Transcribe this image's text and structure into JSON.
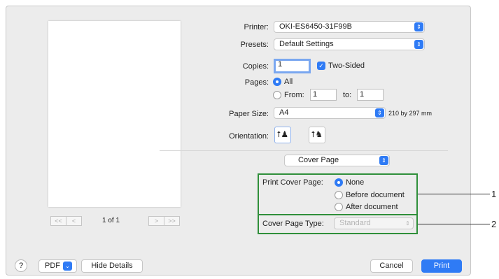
{
  "pager": {
    "first": "<<",
    "prev": "<",
    "label": "1 of 1",
    "next": ">",
    "last": ">>"
  },
  "printer": {
    "label": "Printer:",
    "value": "OKI-ES6450-31F99B"
  },
  "presets": {
    "label": "Presets:",
    "value": "Default Settings"
  },
  "copies": {
    "label": "Copies:",
    "value": "1",
    "two_sided_label": "Two-Sided",
    "two_sided_checked": true
  },
  "pages": {
    "label": "Pages:",
    "all_label": "All",
    "from_label": "From:",
    "from_value": "1",
    "to_label": "to:",
    "to_value": "1",
    "selected": "All"
  },
  "paper_size": {
    "label": "Paper Size:",
    "value": "A4",
    "dimensions": "210 by 297 mm"
  },
  "orientation": {
    "label": "Orientation:",
    "options": [
      "portrait",
      "landscape"
    ],
    "selected": "portrait"
  },
  "section": {
    "value": "Cover Page"
  },
  "cover_page": {
    "label": "Print Cover Page:",
    "options": [
      "None",
      "Before document",
      "After document"
    ],
    "selected": "None",
    "type_label": "Cover Page Type:",
    "type_value": "Standard"
  },
  "callouts": [
    "1",
    "2"
  ],
  "bottom": {
    "help": "?",
    "pdf": "PDF",
    "hide_details": "Hide Details",
    "cancel": "Cancel",
    "print": "Print"
  },
  "colors": {
    "accent": "#2f7bf5",
    "highlight_box": "#2f8f3a"
  }
}
